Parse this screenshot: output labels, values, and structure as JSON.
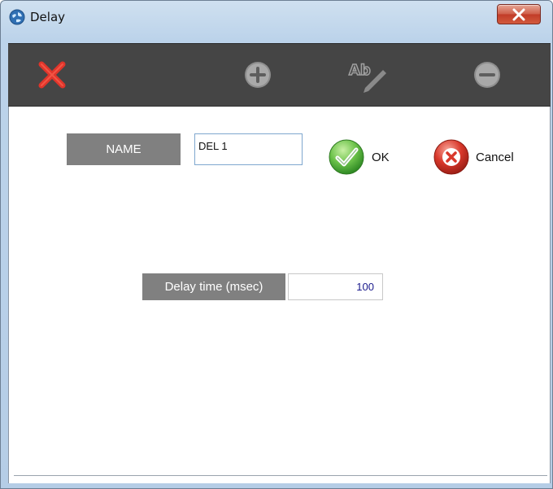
{
  "window": {
    "title": "Delay"
  },
  "toolbar": {
    "delete_icon": "red-x-icon",
    "add_icon": "plus-circle-icon",
    "rename_icon": "rename-ab-pen-icon",
    "remove_icon": "minus-circle-icon"
  },
  "form": {
    "name_label": "NAME",
    "name_value": "DEL 1",
    "ok_label": "OK",
    "cancel_label": "Cancel",
    "delay_label": "Delay time (msec)",
    "delay_value": "100"
  },
  "colors": {
    "toolbar_bg": "#454545",
    "label_bg": "#808080",
    "ok_green": "#4db33d",
    "cancel_red": "#d9382b",
    "delete_red": "#e0352b"
  }
}
